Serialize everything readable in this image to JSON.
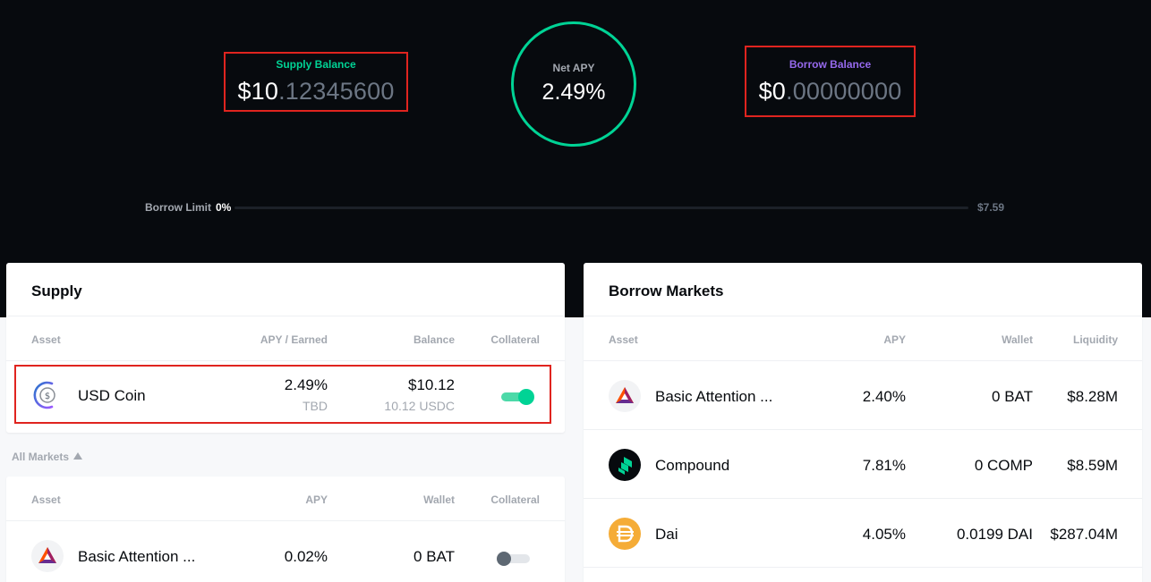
{
  "summary": {
    "supply_label": "Supply Balance",
    "supply_int": "$10",
    "supply_dec": ".12345600",
    "net_apy_label": "Net APY",
    "net_apy_value": "2.49%",
    "borrow_label": "Borrow Balance",
    "borrow_int": "$0",
    "borrow_dec": ".00000000",
    "limit_label": "Borrow Limit",
    "limit_pct": "0%",
    "limit_max": "$7.59",
    "limit_used_fraction": 0
  },
  "colors": {
    "supply_green": "#00d395",
    "borrow_purple": "#9669ed",
    "highlight_red": "#e0241f",
    "bg_dark": "#070a0e"
  },
  "supply": {
    "title": "Supply",
    "headers": [
      "Asset",
      "APY / Earned",
      "Balance",
      "Collateral"
    ],
    "rows": [
      {
        "icon": "usdc-icon",
        "name": "USD Coin",
        "apy": "2.49%",
        "earned": "TBD",
        "balance": "$10.12",
        "balance_sub": "10.12 USDC",
        "collateral": true
      }
    ]
  },
  "all_markets": {
    "label": "All Markets",
    "headers": [
      "Asset",
      "APY",
      "Wallet",
      "Collateral"
    ],
    "rows": [
      {
        "icon": "bat-icon",
        "name": "Basic Attention ...",
        "apy": "0.02%",
        "wallet": "0 BAT",
        "collateral": false
      }
    ]
  },
  "borrow": {
    "title": "Borrow Markets",
    "headers": [
      "Asset",
      "APY",
      "Wallet",
      "Liquidity"
    ],
    "rows": [
      {
        "icon": "bat-icon",
        "name": "Basic Attention ...",
        "apy": "2.40%",
        "wallet": "0 BAT",
        "liquidity": "$8.28M"
      },
      {
        "icon": "comp-icon",
        "name": "Compound",
        "apy": "7.81%",
        "wallet": "0 COMP",
        "liquidity": "$8.59M"
      },
      {
        "icon": "dai-icon",
        "name": "Dai",
        "apy": "4.05%",
        "wallet": "0.0199 DAI",
        "liquidity": "$287.04M"
      }
    ]
  }
}
